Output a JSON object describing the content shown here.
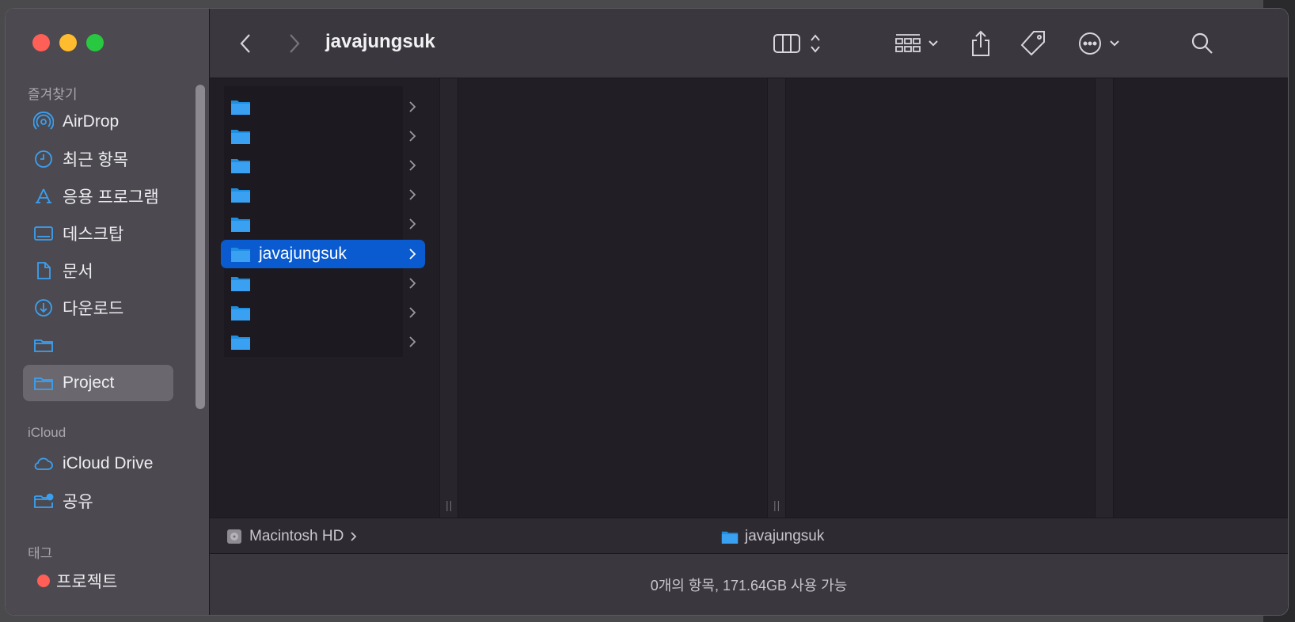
{
  "window": {
    "title": "javajungsuk"
  },
  "sidebar": {
    "favorites_header": "즐겨찾기",
    "favorites": [
      {
        "label": "AirDrop",
        "icon": "airdrop-icon"
      },
      {
        "label": "최근 항목",
        "icon": "clock-icon"
      },
      {
        "label": "응용 프로그램",
        "icon": "applications-icon"
      },
      {
        "label": "데스크탑",
        "icon": "desktop-icon"
      },
      {
        "label": "문서",
        "icon": "document-icon"
      },
      {
        "label": "다운로드",
        "icon": "download-icon"
      },
      {
        "label": "",
        "icon": "folder-icon"
      },
      {
        "label": "Project",
        "icon": "folder-icon",
        "selected": true
      }
    ],
    "icloud_header": "iCloud",
    "icloud": [
      {
        "label": "iCloud Drive",
        "icon": "cloud-icon"
      },
      {
        "label": "공유",
        "icon": "shared-folder-icon"
      }
    ],
    "tags_header": "태그",
    "tags": [
      {
        "label": "프로젝트",
        "color": "#ff5f57"
      }
    ]
  },
  "column1": {
    "rows": [
      {
        "label": ""
      },
      {
        "label": ""
      },
      {
        "label": ""
      },
      {
        "label": ""
      },
      {
        "label": ""
      },
      {
        "label": "javajungsuk",
        "selected": true
      },
      {
        "label": ""
      },
      {
        "label": ""
      },
      {
        "label": ""
      }
    ]
  },
  "pathbar": {
    "root": "Macintosh HD",
    "current": "javajungsuk"
  },
  "statusbar": {
    "text": "0개의 항목, 171.64GB 사용 가능"
  },
  "colors": {
    "accent": "#0a5bd0",
    "folder": "#3aa0f2",
    "tag_red": "#ff5f57"
  }
}
